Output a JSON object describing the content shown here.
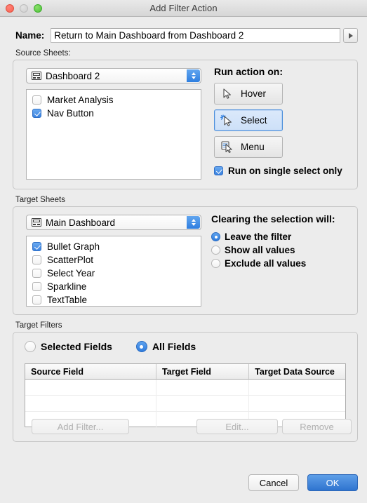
{
  "window": {
    "title": "Add Filter Action",
    "traffic_lights": [
      "close-button",
      "minimize-button",
      "zoom-button"
    ]
  },
  "name_row": {
    "label": "Name:",
    "value": "Return to Main Dashboard from Dashboard 2",
    "placeholder": "",
    "disclosure_icon": "triangle-right-icon"
  },
  "source_sheets": {
    "label": "Source Sheets:",
    "dropdown": {
      "selected": "Dashboard 2",
      "icon": "dashboard-icon"
    },
    "items": [
      {
        "label": "Market Analysis",
        "checked": false
      },
      {
        "label": "Nav Button",
        "checked": true
      }
    ]
  },
  "run_action": {
    "heading": "Run action on:",
    "buttons": [
      {
        "label": "Hover",
        "icon": "cursor-arrow-icon",
        "selected": false
      },
      {
        "label": "Select",
        "icon": "cursor-click-icon",
        "selected": true
      },
      {
        "label": "Menu",
        "icon": "cursor-menu-icon",
        "selected": false
      }
    ],
    "single_select": {
      "label": "Run on single select only",
      "checked": true
    }
  },
  "target_sheets": {
    "label": "Target Sheets",
    "dropdown": {
      "selected": "Main Dashboard",
      "icon": "dashboard-icon"
    },
    "items": [
      {
        "label": "Bullet Graph",
        "checked": true
      },
      {
        "label": "ScatterPlot",
        "checked": false
      },
      {
        "label": "Select Year",
        "checked": false
      },
      {
        "label": "Sparkline",
        "checked": false
      },
      {
        "label": "TextTable",
        "checked": false
      }
    ]
  },
  "clearing": {
    "heading": "Clearing the selection will:",
    "options": [
      {
        "label": "Leave the filter",
        "selected": true
      },
      {
        "label": "Show all values",
        "selected": false
      },
      {
        "label": "Exclude all values",
        "selected": false
      }
    ]
  },
  "target_filters": {
    "label": "Target Filters",
    "field_mode": [
      {
        "label": "Selected Fields",
        "selected": false
      },
      {
        "label": "All Fields",
        "selected": true
      }
    ],
    "table": {
      "columns": [
        "Source Field",
        "Target Field",
        "Target Data Source"
      ],
      "rows": [
        [
          "",
          "",
          ""
        ],
        [
          "",
          "",
          ""
        ],
        [
          "",
          "",
          ""
        ]
      ]
    },
    "buttons": [
      {
        "label": "Add Filter...",
        "enabled": false
      },
      {
        "label": "Edit...",
        "enabled": false
      },
      {
        "label": "Remove",
        "enabled": false
      }
    ]
  },
  "footer": {
    "cancel_label": "Cancel",
    "ok_label": "OK"
  },
  "colors": {
    "accent": "#3b82e0",
    "default_button": "#2f74cf",
    "window_bg": "#ececec",
    "selected_button_bg": "#cde0f8"
  }
}
